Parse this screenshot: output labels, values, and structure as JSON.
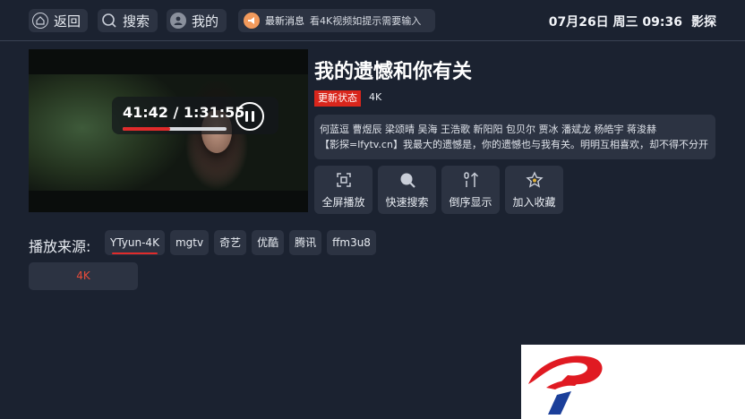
{
  "header": {
    "back_label": "返回",
    "search_label": "搜索",
    "profile_label": "我的",
    "news_title": "最新消息",
    "news_text": "看4K视频如提示需要输入",
    "datetime": "07月26日 周三 09:36",
    "site_name": "影探"
  },
  "player": {
    "current_time": "41:42",
    "separator": " / ",
    "total_time": "1:31:55",
    "progress": 0.454,
    "state": "playing"
  },
  "video": {
    "title": "我的遗憾和你有关",
    "status_badge": "更新状态",
    "quality": "4K",
    "cast": "何蓝逗 曹煜辰 梁颂晴 吴海 王浩歌 新阳阳 包贝尔 贾冰 潘斌龙 杨皓宇 蒋浚赫",
    "description": "【影探=lfytv.cn】我最大的遗憾是，你的遗憾也与我有关。明明互相喜欢，却不得不分开"
  },
  "actions": [
    {
      "label": "全屏播放",
      "icon": "fullscreen-icon"
    },
    {
      "label": "快速搜索",
      "icon": "search-icon"
    },
    {
      "label": "倒序显示",
      "icon": "sort-icon"
    },
    {
      "label": "加入收藏",
      "icon": "star-icon"
    }
  ],
  "sources": {
    "label": "播放来源:",
    "items": [
      "YTyun-4K",
      "mgtv",
      "奇艺",
      "优酷",
      "腾讯",
      "ffm3u8"
    ],
    "active_index": 0
  },
  "episodes": [
    "4K"
  ],
  "colors": {
    "background": "#1b2230",
    "panel": "#2c3342",
    "accent_red": "#e02b2b",
    "episode_text": "#e84b3a",
    "news_icon": "#f29a5c"
  }
}
